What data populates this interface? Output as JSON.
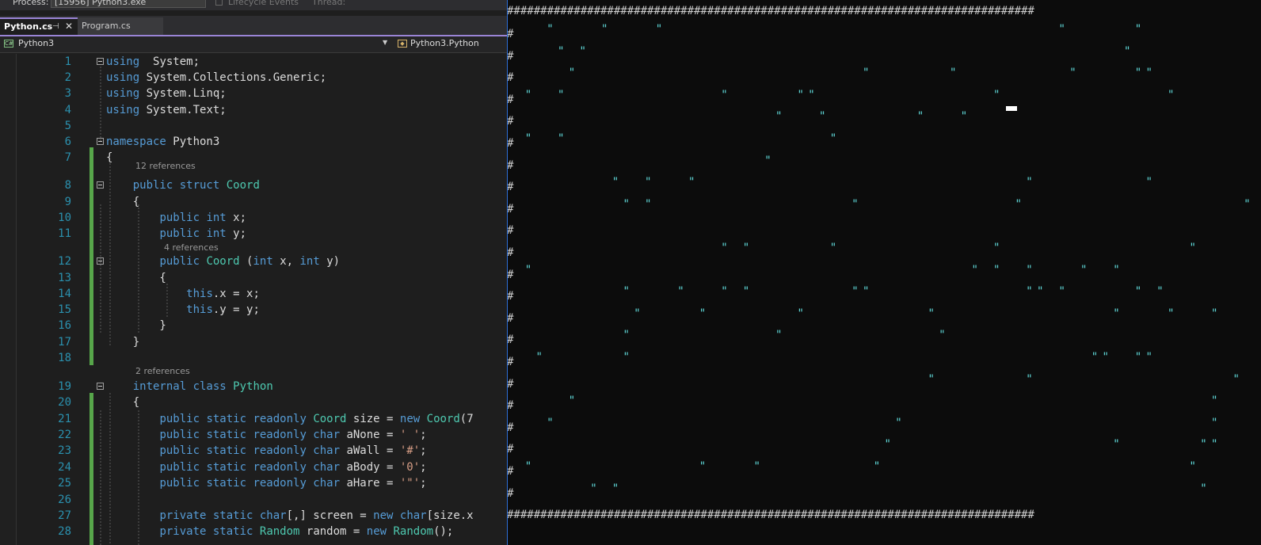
{
  "toolbar": {
    "process_label": "Process:",
    "process_value": "[15956] Python3.exe",
    "lifecycle_label": "Lifecycle Events",
    "thread_label": "Thread:"
  },
  "tabs": [
    {
      "label": "Python.cs",
      "active": true,
      "pin_icon": "pin-icon",
      "close_icon": "close-icon"
    },
    {
      "label": "Program.cs",
      "active": false
    }
  ],
  "navbar": {
    "project": "Python3",
    "type": "Python3.Python",
    "project_icon": "csharp-project-icon",
    "type_icon": "class-icon"
  },
  "editor": {
    "lines": [
      {
        "n": "1",
        "fold": true,
        "segs": [
          [
            "kw",
            "using"
          ],
          [
            "",
            "  System;"
          ]
        ]
      },
      {
        "n": "2",
        "segs": [
          [
            "kw",
            "using"
          ],
          [
            "",
            " System.Collections.Generic;"
          ]
        ]
      },
      {
        "n": "3",
        "segs": [
          [
            "kw",
            "using"
          ],
          [
            "",
            " System.Linq;"
          ]
        ]
      },
      {
        "n": "4",
        "segs": [
          [
            "kw",
            "using"
          ],
          [
            "",
            " System.Text;"
          ]
        ]
      },
      {
        "n": "5",
        "segs": []
      },
      {
        "n": "6",
        "fold": true,
        "segs": [
          [
            "kw",
            "namespace"
          ],
          [
            "",
            " Python3"
          ]
        ]
      },
      {
        "n": "7",
        "segs": [
          [
            "",
            "{"
          ]
        ]
      },
      {
        "n": "8",
        "fold": true,
        "refs": "12 references",
        "segs": [
          [
            "",
            "    "
          ],
          [
            "kw",
            "public struct"
          ],
          [
            "",
            " "
          ],
          [
            "ty",
            "Coord"
          ]
        ]
      },
      {
        "n": "9",
        "segs": [
          [
            "",
            "    {"
          ]
        ]
      },
      {
        "n": "10",
        "segs": [
          [
            "",
            "        "
          ],
          [
            "kw",
            "public int"
          ],
          [
            "",
            " x;"
          ]
        ]
      },
      {
        "n": "11",
        "segs": [
          [
            "",
            "        "
          ],
          [
            "kw",
            "public int"
          ],
          [
            "",
            " y;"
          ]
        ]
      },
      {
        "n": "12",
        "fold": true,
        "refs": "4 references",
        "segs": [
          [
            "",
            "        "
          ],
          [
            "kw",
            "public"
          ],
          [
            "",
            " "
          ],
          [
            "ty",
            "Coord"
          ],
          [
            "",
            " ("
          ],
          [
            "kw",
            "int"
          ],
          [
            "",
            " x, "
          ],
          [
            "kw",
            "int"
          ],
          [
            "",
            " y)"
          ]
        ]
      },
      {
        "n": "13",
        "segs": [
          [
            "",
            "        {"
          ]
        ]
      },
      {
        "n": "14",
        "segs": [
          [
            "",
            "            "
          ],
          [
            "kw",
            "this"
          ],
          [
            "",
            ".x = x;"
          ]
        ]
      },
      {
        "n": "15",
        "segs": [
          [
            "",
            "            "
          ],
          [
            "kw",
            "this"
          ],
          [
            "",
            ".y = y;"
          ]
        ]
      },
      {
        "n": "16",
        "segs": [
          [
            "",
            "        }"
          ]
        ]
      },
      {
        "n": "17",
        "segs": [
          [
            "",
            "    }"
          ]
        ]
      },
      {
        "n": "18",
        "segs": []
      },
      {
        "n": "19",
        "fold": true,
        "refs": "2 references",
        "segs": [
          [
            "",
            "    "
          ],
          [
            "kw",
            "internal class"
          ],
          [
            "",
            " "
          ],
          [
            "ty",
            "Python"
          ]
        ]
      },
      {
        "n": "20",
        "segs": [
          [
            "",
            "    {"
          ]
        ]
      },
      {
        "n": "21",
        "segs": [
          [
            "",
            "        "
          ],
          [
            "kw",
            "public static readonly"
          ],
          [
            "",
            " "
          ],
          [
            "ty",
            "Coord"
          ],
          [
            "",
            " size = "
          ],
          [
            "kw",
            "new"
          ],
          [
            "",
            " "
          ],
          [
            "ty",
            "Coord"
          ],
          [
            "",
            "(7"
          ]
        ]
      },
      {
        "n": "22",
        "segs": [
          [
            "",
            "        "
          ],
          [
            "kw",
            "public static readonly char"
          ],
          [
            "",
            " aNone = "
          ],
          [
            "st",
            "' '"
          ],
          [
            "",
            ";"
          ]
        ]
      },
      {
        "n": "23",
        "segs": [
          [
            "",
            "        "
          ],
          [
            "kw",
            "public static readonly char"
          ],
          [
            "",
            " aWall = "
          ],
          [
            "st",
            "'#'"
          ],
          [
            "",
            ";"
          ]
        ]
      },
      {
        "n": "24",
        "segs": [
          [
            "",
            "        "
          ],
          [
            "kw",
            "public static readonly char"
          ],
          [
            "",
            " aBody = "
          ],
          [
            "st",
            "'0'"
          ],
          [
            "",
            ";"
          ]
        ]
      },
      {
        "n": "25",
        "segs": [
          [
            "",
            "        "
          ],
          [
            "kw",
            "public static readonly char"
          ],
          [
            "",
            " aHare = "
          ],
          [
            "st",
            "'\"'"
          ],
          [
            "",
            ";"
          ]
        ]
      },
      {
        "n": "26",
        "segs": []
      },
      {
        "n": "27",
        "segs": [
          [
            "",
            "        "
          ],
          [
            "kw",
            "private static char"
          ],
          [
            "",
            "[,] screen = "
          ],
          [
            "kw",
            "new char"
          ],
          [
            "",
            "[size.x"
          ]
        ]
      },
      {
        "n": "28",
        "segs": [
          [
            "",
            "        "
          ],
          [
            "kw",
            "private static"
          ],
          [
            "",
            " "
          ],
          [
            "ty",
            "Random"
          ],
          [
            "",
            " random = "
          ],
          [
            "kw",
            "new"
          ],
          [
            "",
            " "
          ],
          [
            "ty",
            "Random"
          ],
          [
            "",
            "();"
          ]
        ]
      }
    ]
  },
  "console": {
    "wall_top": "###############################################################################",
    "wall_bottom": "###############################################################################",
    "wall_side": "#",
    "hare_char": "\"",
    "hare_color": "#5fd7d7",
    "hares": [
      [
        0,
        3
      ],
      [
        0,
        8
      ],
      [
        0,
        13
      ],
      [
        0,
        50
      ],
      [
        0,
        57
      ],
      [
        1,
        4
      ],
      [
        1,
        6
      ],
      [
        1,
        56
      ],
      [
        2,
        5
      ],
      [
        2,
        32
      ],
      [
        2,
        40
      ],
      [
        2,
        51
      ],
      [
        2,
        57
      ],
      [
        2,
        58
      ],
      [
        3,
        1
      ],
      [
        3,
        4
      ],
      [
        3,
        19
      ],
      [
        3,
        26
      ],
      [
        3,
        27
      ],
      [
        3,
        44
      ],
      [
        3,
        60
      ],
      [
        4,
        24
      ],
      [
        4,
        28
      ],
      [
        4,
        37
      ],
      [
        4,
        41
      ],
      [
        5,
        1
      ],
      [
        5,
        4
      ],
      [
        5,
        29
      ],
      [
        6,
        23
      ],
      [
        7,
        9
      ],
      [
        7,
        12
      ],
      [
        7,
        16
      ],
      [
        7,
        47
      ],
      [
        7,
        58
      ],
      [
        8,
        10
      ],
      [
        8,
        12
      ],
      [
        8,
        31
      ],
      [
        8,
        46
      ],
      [
        8,
        67
      ],
      [
        10,
        19
      ],
      [
        10,
        21
      ],
      [
        10,
        29
      ],
      [
        10,
        44
      ],
      [
        10,
        62
      ],
      [
        11,
        1
      ],
      [
        11,
        42
      ],
      [
        11,
        44
      ],
      [
        11,
        47
      ],
      [
        11,
        52
      ],
      [
        11,
        55
      ],
      [
        12,
        10
      ],
      [
        12,
        15
      ],
      [
        12,
        19
      ],
      [
        12,
        21
      ],
      [
        12,
        31
      ],
      [
        12,
        32
      ],
      [
        12,
        47
      ],
      [
        12,
        48
      ],
      [
        12,
        50
      ],
      [
        12,
        57
      ],
      [
        12,
        59
      ],
      [
        13,
        11
      ],
      [
        13,
        17
      ],
      [
        13,
        26
      ],
      [
        13,
        38
      ],
      [
        13,
        55
      ],
      [
        13,
        60
      ],
      [
        13,
        64
      ],
      [
        14,
        10
      ],
      [
        14,
        24
      ],
      [
        14,
        39
      ],
      [
        15,
        2
      ],
      [
        15,
        10
      ],
      [
        15,
        53
      ],
      [
        15,
        54
      ],
      [
        15,
        57
      ],
      [
        15,
        58
      ],
      [
        16,
        38
      ],
      [
        16,
        47
      ],
      [
        16,
        66
      ],
      [
        17,
        5
      ],
      [
        17,
        64
      ],
      [
        18,
        3
      ],
      [
        18,
        35
      ],
      [
        18,
        64
      ],
      [
        19,
        34
      ],
      [
        19,
        55
      ],
      [
        19,
        63
      ],
      [
        19,
        64
      ],
      [
        20,
        1
      ],
      [
        20,
        17
      ],
      [
        20,
        22
      ],
      [
        20,
        33
      ],
      [
        20,
        62
      ],
      [
        21,
        7
      ],
      [
        21,
        9
      ],
      [
        21,
        63
      ]
    ]
  }
}
